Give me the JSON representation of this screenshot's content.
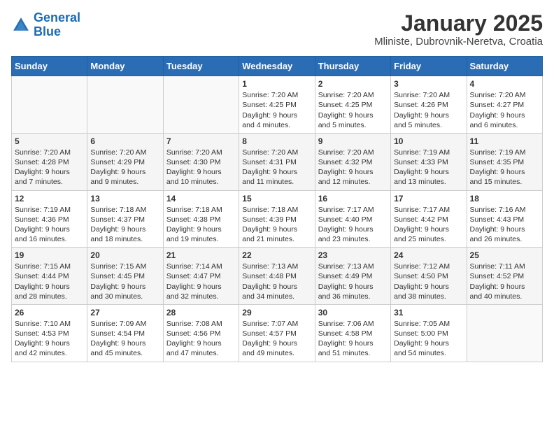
{
  "header": {
    "logo_line1": "General",
    "logo_line2": "Blue",
    "calendar_title": "January 2025",
    "calendar_subtitle": "Mliniste, Dubrovnik-Neretva, Croatia"
  },
  "weekdays": [
    "Sunday",
    "Monday",
    "Tuesday",
    "Wednesday",
    "Thursday",
    "Friday",
    "Saturday"
  ],
  "weeks": [
    [
      {
        "day": "",
        "info": ""
      },
      {
        "day": "",
        "info": ""
      },
      {
        "day": "",
        "info": ""
      },
      {
        "day": "1",
        "info": "Sunrise: 7:20 AM\nSunset: 4:25 PM\nDaylight: 9 hours\nand 4 minutes."
      },
      {
        "day": "2",
        "info": "Sunrise: 7:20 AM\nSunset: 4:25 PM\nDaylight: 9 hours\nand 5 minutes."
      },
      {
        "day": "3",
        "info": "Sunrise: 7:20 AM\nSunset: 4:26 PM\nDaylight: 9 hours\nand 5 minutes."
      },
      {
        "day": "4",
        "info": "Sunrise: 7:20 AM\nSunset: 4:27 PM\nDaylight: 9 hours\nand 6 minutes."
      }
    ],
    [
      {
        "day": "5",
        "info": "Sunrise: 7:20 AM\nSunset: 4:28 PM\nDaylight: 9 hours\nand 7 minutes."
      },
      {
        "day": "6",
        "info": "Sunrise: 7:20 AM\nSunset: 4:29 PM\nDaylight: 9 hours\nand 9 minutes."
      },
      {
        "day": "7",
        "info": "Sunrise: 7:20 AM\nSunset: 4:30 PM\nDaylight: 9 hours\nand 10 minutes."
      },
      {
        "day": "8",
        "info": "Sunrise: 7:20 AM\nSunset: 4:31 PM\nDaylight: 9 hours\nand 11 minutes."
      },
      {
        "day": "9",
        "info": "Sunrise: 7:20 AM\nSunset: 4:32 PM\nDaylight: 9 hours\nand 12 minutes."
      },
      {
        "day": "10",
        "info": "Sunrise: 7:19 AM\nSunset: 4:33 PM\nDaylight: 9 hours\nand 13 minutes."
      },
      {
        "day": "11",
        "info": "Sunrise: 7:19 AM\nSunset: 4:35 PM\nDaylight: 9 hours\nand 15 minutes."
      }
    ],
    [
      {
        "day": "12",
        "info": "Sunrise: 7:19 AM\nSunset: 4:36 PM\nDaylight: 9 hours\nand 16 minutes."
      },
      {
        "day": "13",
        "info": "Sunrise: 7:18 AM\nSunset: 4:37 PM\nDaylight: 9 hours\nand 18 minutes."
      },
      {
        "day": "14",
        "info": "Sunrise: 7:18 AM\nSunset: 4:38 PM\nDaylight: 9 hours\nand 19 minutes."
      },
      {
        "day": "15",
        "info": "Sunrise: 7:18 AM\nSunset: 4:39 PM\nDaylight: 9 hours\nand 21 minutes."
      },
      {
        "day": "16",
        "info": "Sunrise: 7:17 AM\nSunset: 4:40 PM\nDaylight: 9 hours\nand 23 minutes."
      },
      {
        "day": "17",
        "info": "Sunrise: 7:17 AM\nSunset: 4:42 PM\nDaylight: 9 hours\nand 25 minutes."
      },
      {
        "day": "18",
        "info": "Sunrise: 7:16 AM\nSunset: 4:43 PM\nDaylight: 9 hours\nand 26 minutes."
      }
    ],
    [
      {
        "day": "19",
        "info": "Sunrise: 7:15 AM\nSunset: 4:44 PM\nDaylight: 9 hours\nand 28 minutes."
      },
      {
        "day": "20",
        "info": "Sunrise: 7:15 AM\nSunset: 4:45 PM\nDaylight: 9 hours\nand 30 minutes."
      },
      {
        "day": "21",
        "info": "Sunrise: 7:14 AM\nSunset: 4:47 PM\nDaylight: 9 hours\nand 32 minutes."
      },
      {
        "day": "22",
        "info": "Sunrise: 7:13 AM\nSunset: 4:48 PM\nDaylight: 9 hours\nand 34 minutes."
      },
      {
        "day": "23",
        "info": "Sunrise: 7:13 AM\nSunset: 4:49 PM\nDaylight: 9 hours\nand 36 minutes."
      },
      {
        "day": "24",
        "info": "Sunrise: 7:12 AM\nSunset: 4:50 PM\nDaylight: 9 hours\nand 38 minutes."
      },
      {
        "day": "25",
        "info": "Sunrise: 7:11 AM\nSunset: 4:52 PM\nDaylight: 9 hours\nand 40 minutes."
      }
    ],
    [
      {
        "day": "26",
        "info": "Sunrise: 7:10 AM\nSunset: 4:53 PM\nDaylight: 9 hours\nand 42 minutes."
      },
      {
        "day": "27",
        "info": "Sunrise: 7:09 AM\nSunset: 4:54 PM\nDaylight: 9 hours\nand 45 minutes."
      },
      {
        "day": "28",
        "info": "Sunrise: 7:08 AM\nSunset: 4:56 PM\nDaylight: 9 hours\nand 47 minutes."
      },
      {
        "day": "29",
        "info": "Sunrise: 7:07 AM\nSunset: 4:57 PM\nDaylight: 9 hours\nand 49 minutes."
      },
      {
        "day": "30",
        "info": "Sunrise: 7:06 AM\nSunset: 4:58 PM\nDaylight: 9 hours\nand 51 minutes."
      },
      {
        "day": "31",
        "info": "Sunrise: 7:05 AM\nSunset: 5:00 PM\nDaylight: 9 hours\nand 54 minutes."
      },
      {
        "day": "",
        "info": ""
      }
    ]
  ]
}
